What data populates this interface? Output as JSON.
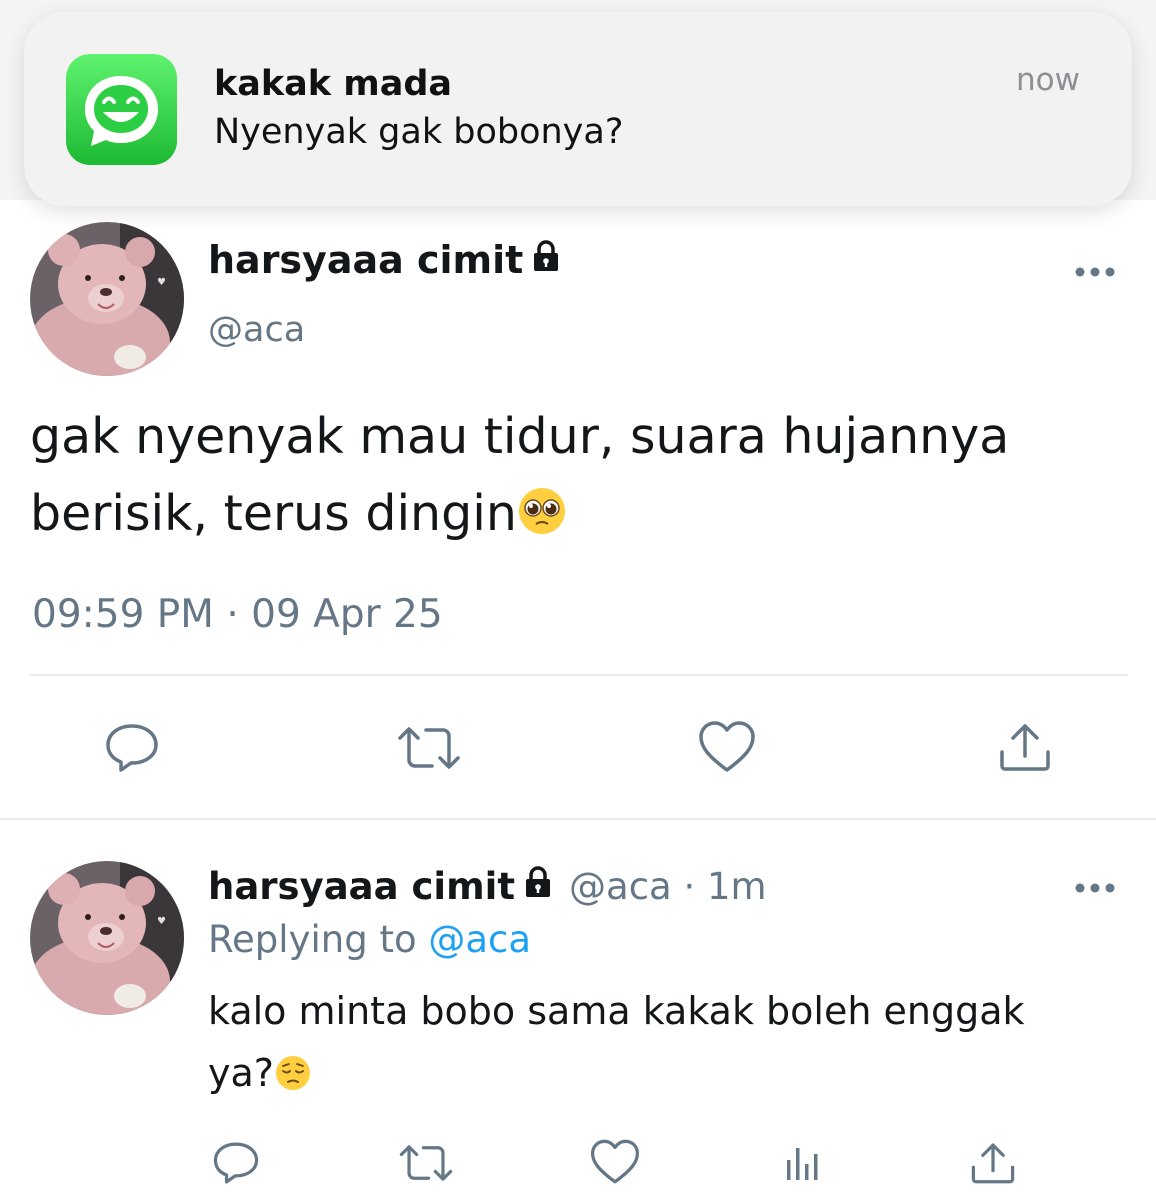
{
  "notification": {
    "app_icon": "whatsapp-smile-icon",
    "sender": "kakak mada",
    "message": "Nyenyak gak bobonya?",
    "time": "now"
  },
  "tweet": {
    "display_name": "harsyaaa cimit",
    "handle": "@aca",
    "text_line1": "gak nyenyak mau tidur, suara hujannya",
    "text_line2": "berisik, terus dingin",
    "emoji": "pleading-face",
    "timestamp": "09:59 PM · 09 Apr 25",
    "actions": [
      "reply-icon",
      "retweet-icon",
      "like-icon",
      "share-icon"
    ]
  },
  "reply": {
    "display_name": "harsyaaa cimit",
    "meta": "@aca · 1m",
    "replying_prefix": "Replying to",
    "replying_to": "@aca",
    "text_line1": "kalo minta bobo sama kakak boleh enggak",
    "text_line2": "ya?",
    "emoji": "pensive-face",
    "actions": [
      "reply-icon",
      "retweet-icon",
      "like-icon",
      "analytics-icon",
      "share-icon"
    ]
  },
  "colors": {
    "text": "#14171a",
    "secondary": "#657786",
    "link": "#1da1f2",
    "divider": "#e6ecf0",
    "notification_bg": "#f2f2f2",
    "whatsapp_green": "#25d33a"
  }
}
